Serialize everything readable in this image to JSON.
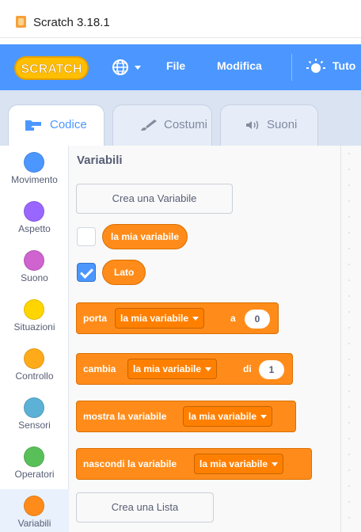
{
  "window": {
    "title": "Scratch 3.18.1"
  },
  "menubar": {
    "logo_text": "SCRATCH",
    "items": [
      "File",
      "Modifica",
      "Tuto"
    ]
  },
  "tabs": [
    {
      "label": "Codice",
      "icon": "code-icon",
      "active": true
    },
    {
      "label": "Costumi",
      "icon": "brush-icon",
      "active": false
    },
    {
      "label": "Suoni",
      "icon": "speaker-icon",
      "active": false
    }
  ],
  "categories": [
    {
      "label": "Movimento",
      "color": "#4c97ff"
    },
    {
      "label": "Aspetto",
      "color": "#9966ff"
    },
    {
      "label": "Suono",
      "color": "#cf63cf"
    },
    {
      "label": "Situazioni",
      "color": "#ffd500"
    },
    {
      "label": "Controllo",
      "color": "#ffab19"
    },
    {
      "label": "Sensori",
      "color": "#5cb1d6"
    },
    {
      "label": "Operatori",
      "color": "#59c059"
    },
    {
      "label": "Variabili",
      "color": "#ff8c1a"
    }
  ],
  "palette": {
    "heading": "Variabili",
    "make_variable": "Crea una Variabile",
    "variables": [
      {
        "name": "la mia variabile",
        "checked": false
      },
      {
        "name": "Lato",
        "checked": true
      }
    ],
    "set_block": {
      "verb": "porta",
      "var": "la mia variabile",
      "joiner": "a",
      "value": "0"
    },
    "change_block": {
      "verb": "cambia",
      "var": "la mia variabile",
      "joiner": "di",
      "value": "1"
    },
    "show_block": {
      "verb": "mostra la variabile",
      "var": "la mia variabile"
    },
    "hide_block": {
      "verb": "nascondi la variabile",
      "var": "la mia variabile"
    },
    "make_list": "Crea una Lista"
  },
  "colors": {
    "menubar": "#4c97ff",
    "variables": "#ff8c1a",
    "active_tab_text": "#4c97ff"
  }
}
